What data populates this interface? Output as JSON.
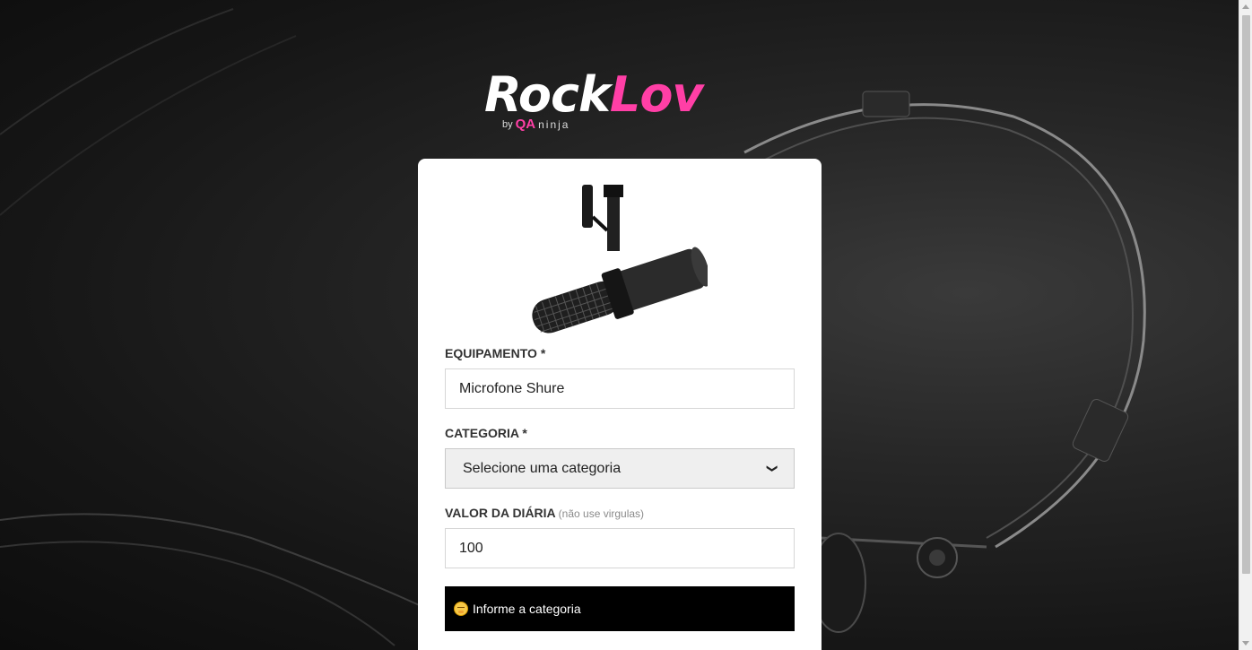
{
  "logo": {
    "rock": "Rock",
    "lov": "Lov",
    "by": "by",
    "qa": "QA",
    "ninja": "ninja"
  },
  "form": {
    "equipment_label": "EQUIPAMENTO *",
    "equipment_value": "Microfone Shure",
    "category_label": "CATEGORIA *",
    "category_selected": "Selecione uma categoria",
    "price_label": "VALOR DA DIÁRIA",
    "price_hint": "(não use virgulas)",
    "price_value": "100",
    "alert_text": "Informe a categoria"
  },
  "icons": {
    "thumbnail": "microphone-thumbnail",
    "alert": "face-emoji-icon",
    "select_arrow": "chevron-down-icon"
  },
  "colors": {
    "brand_pink": "#ff3fa6",
    "card_bg": "#ffffff",
    "alert_bg": "#000000"
  }
}
